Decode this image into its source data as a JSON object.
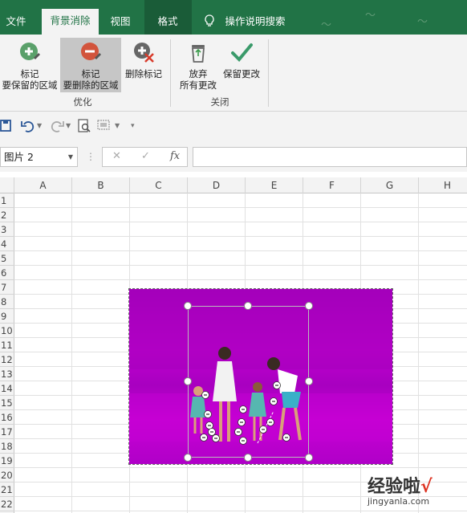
{
  "tabs": [
    {
      "label": "文件",
      "active": false
    },
    {
      "label": "背景消除",
      "active": true
    },
    {
      "label": "视图",
      "active": false
    },
    {
      "label": "格式",
      "active": false
    }
  ],
  "tell_me": "操作说明搜索",
  "ribbon": {
    "mark_keep": {
      "line1": "标记",
      "line2": "要保留的区域"
    },
    "mark_remove": {
      "line1": "标记",
      "line2": "要删除的区域"
    },
    "delete_mark": {
      "line1": "删除标记"
    },
    "discard": {
      "line1": "放弃",
      "line2": "所有更改"
    },
    "keep_changes": {
      "line1": "保留更改"
    },
    "group_refine": "优化",
    "group_close": "关闭"
  },
  "formula_bar": {
    "name_box": "图片 2",
    "cancel": "✕",
    "enter": "✓",
    "fx": "fx",
    "value": ""
  },
  "columns": [
    "A",
    "B",
    "C",
    "D",
    "E",
    "F",
    "G",
    "H"
  ],
  "rows": [
    "1",
    "2",
    "3",
    "4",
    "5",
    "6",
    "7",
    "8",
    "9",
    "10",
    "11",
    "12",
    "13",
    "14",
    "15",
    "16",
    "17",
    "18",
    "19",
    "20",
    "21",
    "22"
  ],
  "watermark": {
    "brand": "经验啦",
    "check": "√",
    "url": "jingyanla.com"
  },
  "colors": {
    "excel_green": "#217346",
    "ribbon_bg": "#f3f3f3",
    "removal_overlay": "#b000c8",
    "keep_mark": "#5aa06a",
    "remove_mark": "#d2543c"
  }
}
